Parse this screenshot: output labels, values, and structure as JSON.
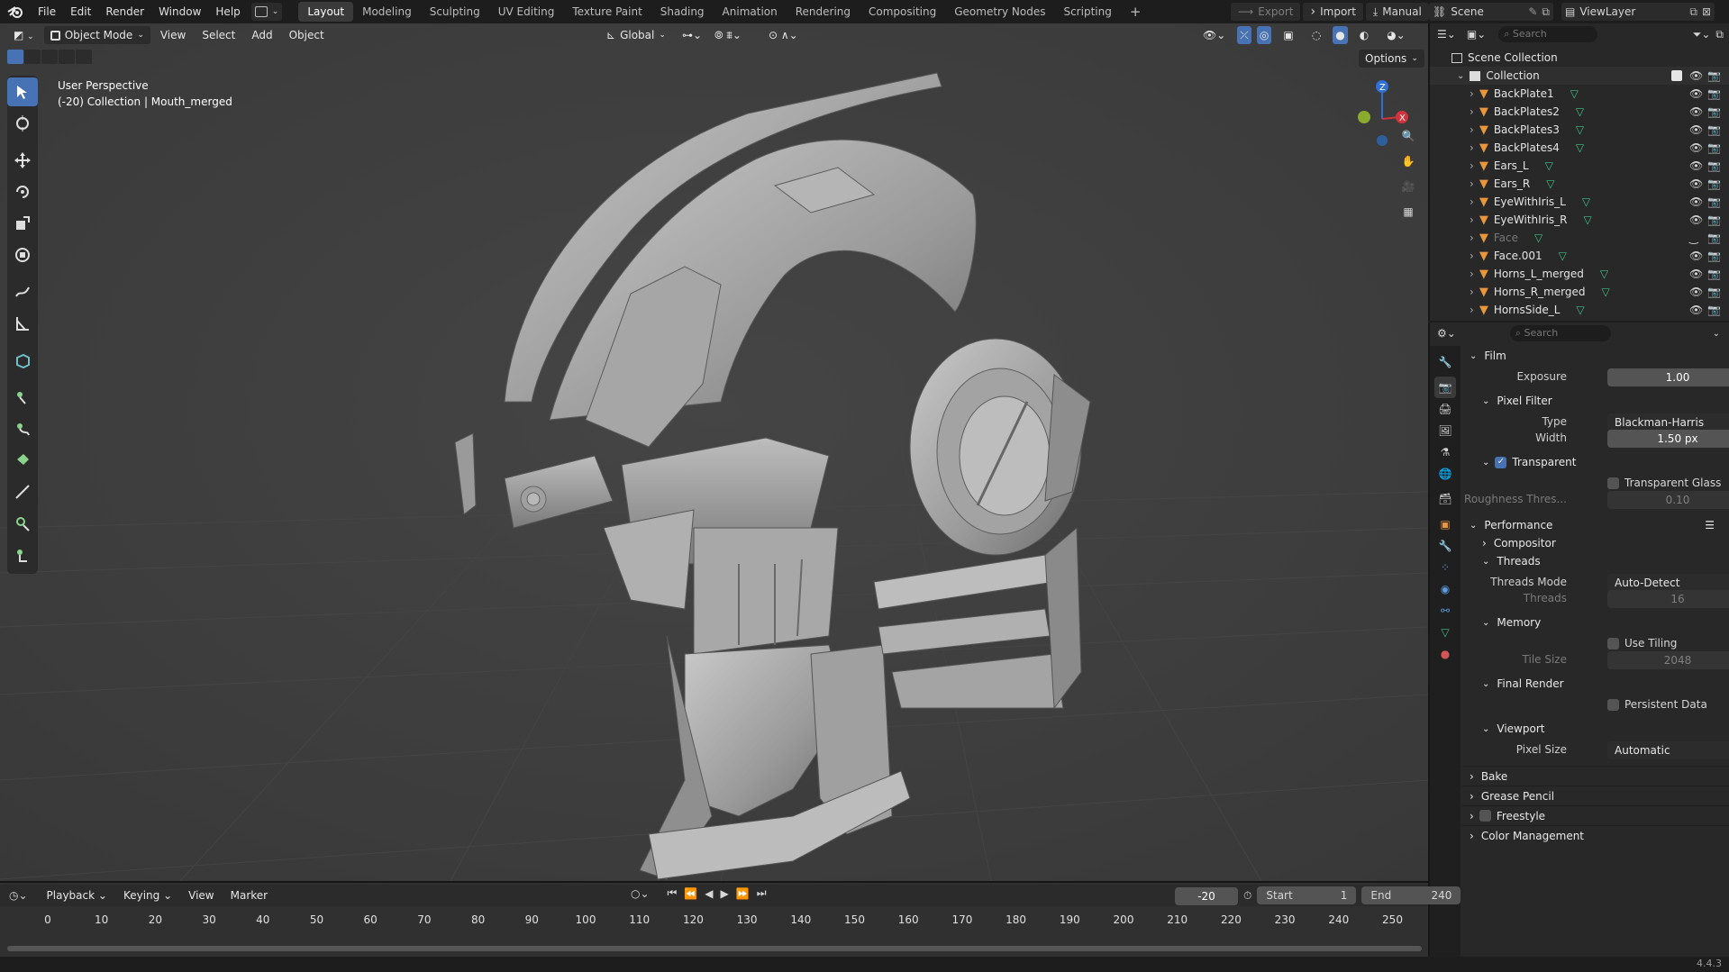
{
  "menu": {
    "file": "File",
    "edit": "Edit",
    "render": "Render",
    "window": "Window",
    "help": "Help"
  },
  "workspaces": [
    "Layout",
    "Modeling",
    "Sculpting",
    "UV Editing",
    "Texture Paint",
    "Shading",
    "Animation",
    "Rendering",
    "Compositing",
    "Geometry Nodes",
    "Scripting"
  ],
  "topbar_right": {
    "export": "Export",
    "import": "Import",
    "manual": "Manual",
    "scene": "Scene",
    "view_layer": "ViewLayer"
  },
  "viewport": {
    "mode": "Object Mode",
    "view": "View",
    "select": "Select",
    "add": "Add",
    "object": "Object",
    "orientation": "Global",
    "options": "Options",
    "info_line1": "User Perspective",
    "info_line2": "(-20) Collection | Mouth_merged"
  },
  "outliner": {
    "search_placeholder": "Search",
    "scene_collection": "Scene Collection",
    "collection": "Collection",
    "items": [
      "BackPlate1",
      "BackPlates2",
      "BackPlates3",
      "BackPlates4",
      "Ears_L",
      "Ears_R",
      "EyeWithIris_L",
      "EyeWithIris_R",
      "Face",
      "Face.001",
      "Horns_L_merged",
      "Horns_R_merged",
      "HornsSide_L"
    ]
  },
  "properties": {
    "search_placeholder": "Search",
    "film": "Film",
    "exposure_label": "Exposure",
    "exposure_value": "1.00",
    "pixel_filter": "Pixel Filter",
    "type_label": "Type",
    "type_value": "Blackman-Harris",
    "width_label": "Width",
    "width_value": "1.50 px",
    "transparent": "Transparent",
    "transparent_glass": "Transparent Glass",
    "roughness_label": "Roughness Thres...",
    "roughness_value": "0.10",
    "performance": "Performance",
    "compositor": "Compositor",
    "threads": "Threads",
    "threads_mode_label": "Threads Mode",
    "threads_mode_value": "Auto-Detect",
    "threads_label": "Threads",
    "threads_value": "16",
    "memory": "Memory",
    "use_tiling": "Use Tiling",
    "tile_size_label": "Tile Size",
    "tile_size_value": "2048",
    "final_render": "Final Render",
    "persistent_data": "Persistent Data",
    "viewport": "Viewport",
    "pixel_size_label": "Pixel Size",
    "pixel_size_value": "Automatic",
    "bake": "Bake",
    "grease_pencil": "Grease Pencil",
    "freestyle": "Freestyle",
    "color_management": "Color Management"
  },
  "timeline": {
    "playback": "Playback",
    "keying": "Keying",
    "view": "View",
    "marker": "Marker",
    "current_frame": "-20",
    "start_label": "Start",
    "start_value": "1",
    "end_label": "End",
    "end_value": "240",
    "ticks": [
      "0",
      "10",
      "20",
      "30",
      "40",
      "50",
      "60",
      "70",
      "80",
      "90",
      "100",
      "110",
      "120",
      "130",
      "140",
      "150",
      "160",
      "170",
      "180",
      "190",
      "200",
      "210",
      "220",
      "230",
      "240",
      "250"
    ]
  },
  "status": {
    "version": "4.4.3"
  },
  "colors": {
    "accent": "#4772b3",
    "object_orange": "#e8953c",
    "mesh_green": "#3fbf8a"
  }
}
